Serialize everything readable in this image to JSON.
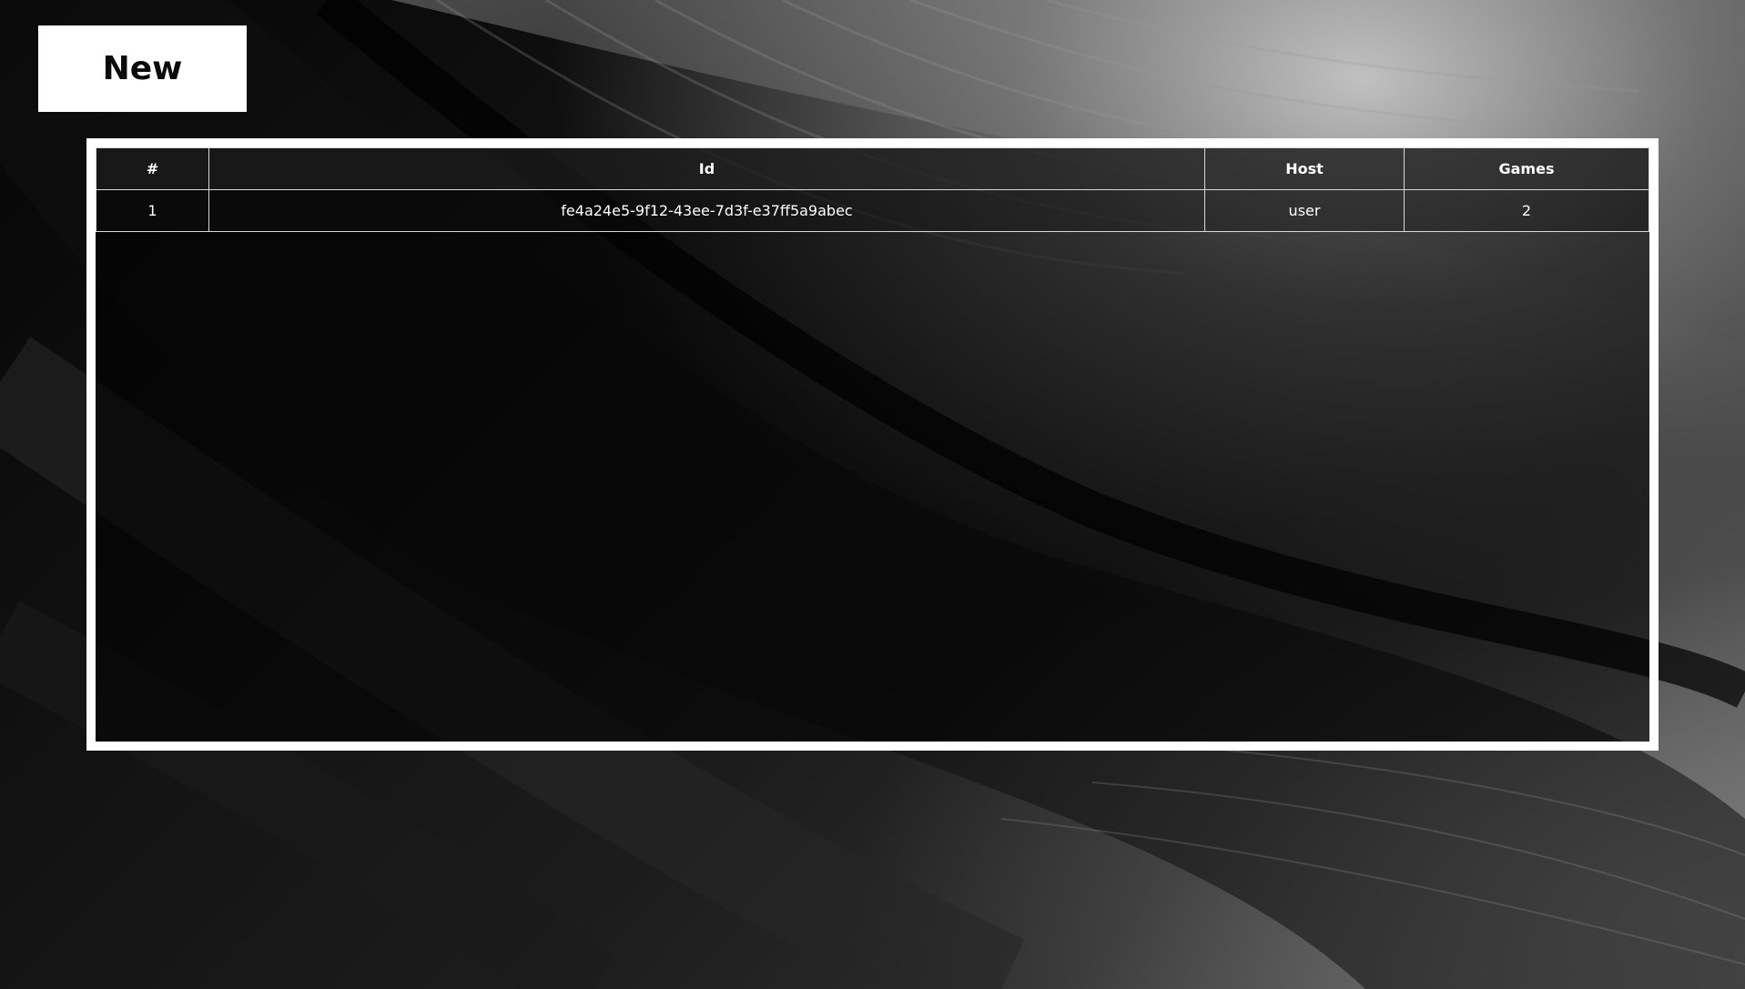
{
  "toolbar": {
    "new_label": "New"
  },
  "table": {
    "headers": {
      "num": "#",
      "id": "Id",
      "host": "Host",
      "games": "Games"
    },
    "rows": [
      {
        "num": "1",
        "id": "fe4a24e5-9f12-43ee-7d3f-e37ff5a9abec",
        "host": "user",
        "games": "2"
      }
    ]
  },
  "colors": {
    "frame": "#ffffff",
    "text": "#ffffff",
    "button_bg": "#ffffff",
    "button_text": "#0b0b0b"
  }
}
